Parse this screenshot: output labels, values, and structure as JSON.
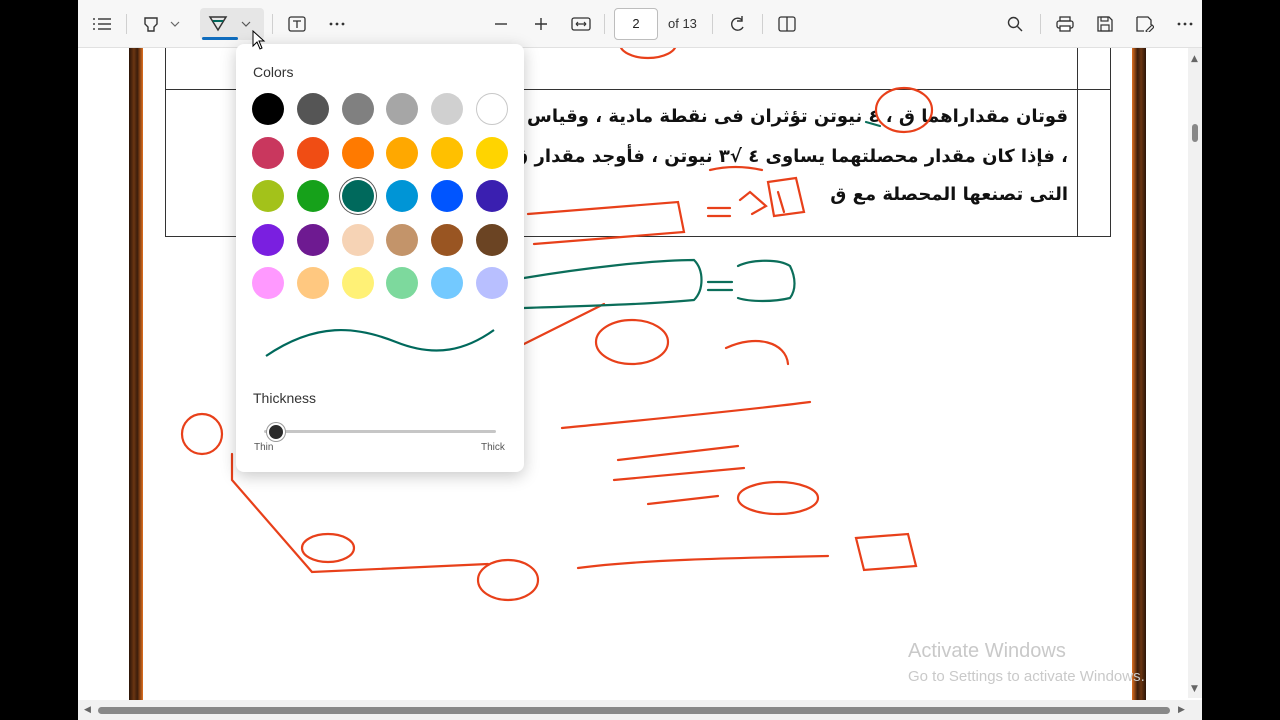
{
  "toolbar": {
    "page_number": "2",
    "page_total": "of 13",
    "icons": [
      "contents-icon",
      "highlight-icon",
      "draw-icon",
      "text-box-icon",
      "more-options-icon",
      "zoom-out-icon",
      "zoom-in-icon",
      "fit-width-icon",
      "rotate-icon",
      "page-view-icon",
      "search-icon",
      "print-icon",
      "save-icon",
      "save-as-icon",
      "settings-more-icon"
    ],
    "accent_color": "#0f6cbd"
  },
  "popup": {
    "colors_title": "Colors",
    "thickness_title": "Thickness",
    "thin_label": "Thin",
    "thick_label": "Thick",
    "thickness_value": 0.05,
    "selected_color": "#00695c",
    "colors": [
      "#000000",
      "#555555",
      "#808080",
      "#a6a6a6",
      "#d0d0d0",
      "#ffffff",
      "#c9375e",
      "#f04d14",
      "#ff7a00",
      "#ffa800",
      "#ffc000",
      "#ffd400",
      "#a3c21a",
      "#16a11a",
      "#00695c",
      "#0095d6",
      "#0055ff",
      "#3a1fb0",
      "#7a1fe0",
      "#6e1a91",
      "#f6d3b5",
      "#c3946a",
      "#995522",
      "#6b4423",
      "#ff99ff",
      "#ffc880",
      "#fff176",
      "#7dd99d",
      "#73c9ff",
      "#b8bfff"
    ]
  },
  "document": {
    "question_lines": [
      "قوتان مقداراهما ق ، ٤ نيوتن تؤثران فى نقطة مادية ، وقياس الزاوية",
      "، فإذا كان مقدار محصلتهما يساوى ٤ √٣ نيوتن ، فأوجد مقدار ق",
      "التى تصنعها المحصلة مع ق"
    ]
  },
  "watermark": {
    "title": "Activate Windows",
    "subtitle": "Go to Settings to activate Windows."
  }
}
